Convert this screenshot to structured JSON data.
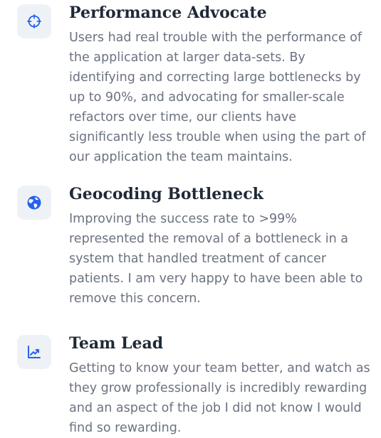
{
  "features": [
    {
      "title": "Performance Advocate",
      "description": "Users had real trouble with the performance of the application at larger data-sets. By identifying and correcting large bottlenecks by up to 90%, and advocating for smaller-scale refactors over time, our clients have significantly less trouble when using the part of our application the team maintains.",
      "icon": "crosshair-icon"
    },
    {
      "title": "Geocoding Bottleneck",
      "description": "Improving the success rate to >99% represented the removal of a bottleneck in a system that handled treatment of cancer patients. I am very happy to have been able to remove this concern.",
      "icon": "globe-icon"
    },
    {
      "title": "Team Lead",
      "description": "Getting to know your team better, and watch as they grow professionally is incredibly rewarding and an aspect of the job I did not know I would find so rewarding.",
      "icon": "trending-up-icon"
    }
  ],
  "colors": {
    "accent": "#2563eb",
    "icon_bg": "#eef2f7",
    "title": "#1f2937",
    "body_text": "#6b7280"
  }
}
